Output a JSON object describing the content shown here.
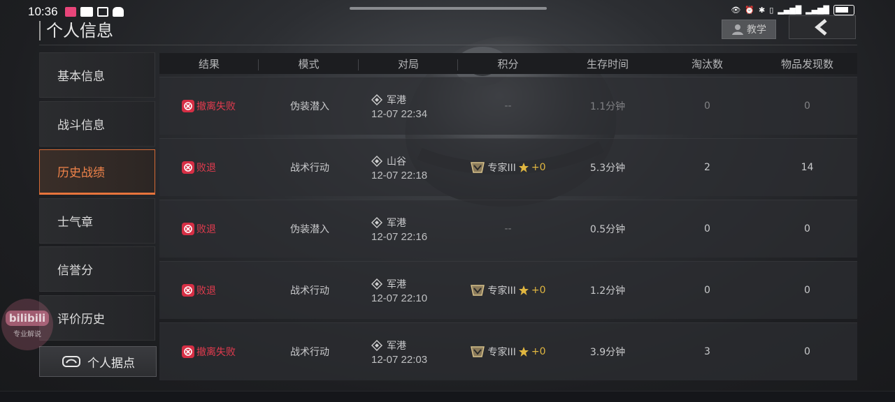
{
  "status_bar": {
    "time": "10:36"
  },
  "header": {
    "title": "个人信息",
    "teach_label": "教学"
  },
  "sidebar": {
    "items": [
      {
        "label": "基本信息"
      },
      {
        "label": "战斗信息"
      },
      {
        "label": "历史战绩",
        "active": true
      },
      {
        "label": "士气章"
      },
      {
        "label": "信誉分"
      },
      {
        "label": "评价历史"
      }
    ],
    "base_button": "个人据点"
  },
  "table": {
    "headers": [
      "结果",
      "模式",
      "对局",
      "积分",
      "生存时间",
      "淘汰数",
      "物品发现数"
    ],
    "rows": [
      {
        "result": "撤离失败",
        "mode": "伪装潜入",
        "map": "军港",
        "time": "12-07 22:34",
        "score": "--",
        "score_rank": "",
        "score_plus": "",
        "survival": "1.1分钟",
        "kills": "0",
        "items": "0",
        "dimmed": true
      },
      {
        "result": "败退",
        "mode": "战术行动",
        "map": "山谷",
        "time": "12-07 22:18",
        "score": "",
        "score_rank": "专家III",
        "score_plus": "+0",
        "survival": "5.3分钟",
        "kills": "2",
        "items": "14",
        "dimmed": false
      },
      {
        "result": "败退",
        "mode": "伪装潜入",
        "map": "军港",
        "time": "12-07 22:16",
        "score": "--",
        "score_rank": "",
        "score_plus": "",
        "survival": "0.5分钟",
        "kills": "0",
        "items": "0",
        "dimmed": false
      },
      {
        "result": "败退",
        "mode": "战术行动",
        "map": "军港",
        "time": "12-07 22:10",
        "score": "",
        "score_rank": "专家III",
        "score_plus": "+0",
        "survival": "1.2分钟",
        "kills": "0",
        "items": "0",
        "dimmed": false
      },
      {
        "result": "撤离失败",
        "mode": "战术行动",
        "map": "军港",
        "time": "12-07 22:03",
        "score": "",
        "score_rank": "专家III",
        "score_plus": "+0",
        "survival": "3.9分钟",
        "kills": "3",
        "items": "0",
        "dimmed": false
      }
    ]
  },
  "watermark": {
    "logo": "bilibili",
    "sub": "专业解说"
  },
  "colors": {
    "accent": "#e8743c",
    "result_red": "#e33b4e",
    "gold": "#e0b640"
  }
}
